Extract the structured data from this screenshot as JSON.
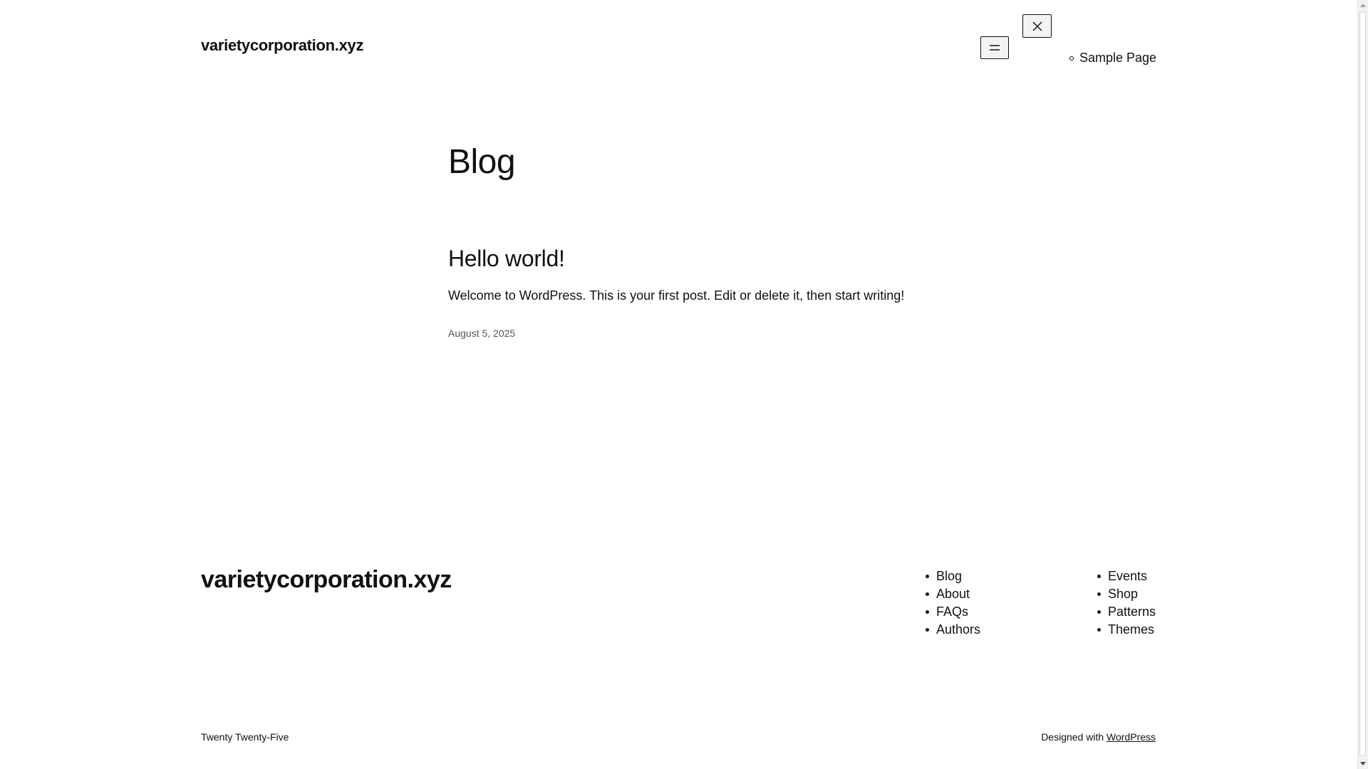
{
  "header": {
    "site_title": "varietycorporation.xyz",
    "nav_items": [
      {
        "label": "Sample Page"
      }
    ]
  },
  "main": {
    "page_heading": "Blog",
    "posts": [
      {
        "title": "Hello world!",
        "excerpt": "Welcome to WordPress. This is your first post. Edit or delete it, then start writing!",
        "date": "August 5, 2025"
      }
    ]
  },
  "footer": {
    "site_title": "varietycorporation.xyz",
    "nav_col1": [
      {
        "label": "Blog"
      },
      {
        "label": "About"
      },
      {
        "label": "FAQs"
      },
      {
        "label": "Authors"
      }
    ],
    "nav_col2": [
      {
        "label": "Events"
      },
      {
        "label": "Shop"
      },
      {
        "label": "Patterns"
      },
      {
        "label": "Themes"
      }
    ],
    "theme_credit": "Twenty Twenty-Five",
    "designed_with": "Designed with",
    "designed_link": "WordPress"
  },
  "icons": {
    "menu_open": "hamburger-menu-icon",
    "menu_close": "close-icon"
  }
}
